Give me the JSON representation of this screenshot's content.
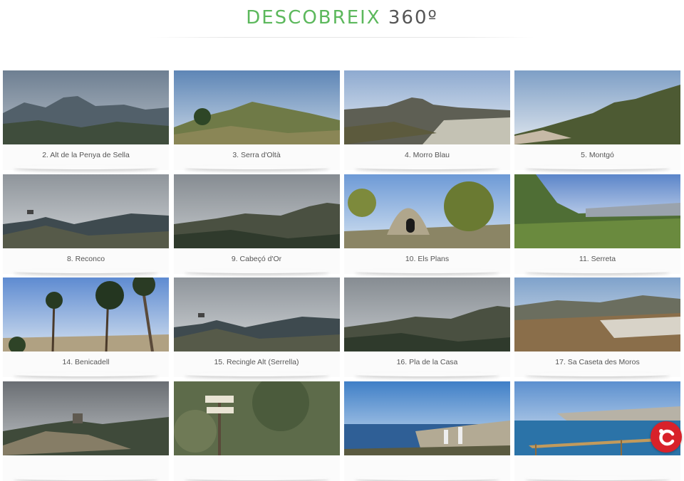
{
  "page": {
    "title_accent": "DESCOBREIX",
    "title_rest": "360º"
  },
  "cards": [
    {
      "label": "2. Alt de la Penya de Sella",
      "scene": "mountain"
    },
    {
      "label": "3. Serra d'Oltà",
      "scene": "hill"
    },
    {
      "label": "4. Morro Blau",
      "scene": "peak-sea"
    },
    {
      "label": "5. Montgó",
      "scene": "ridge-cloud"
    },
    {
      "label": "8. Reconco",
      "scene": "overcast-ridge"
    },
    {
      "label": "9. Cabeçó d'Or",
      "scene": "overcast-rocks"
    },
    {
      "label": "10. Els Plans",
      "scene": "stone-hut"
    },
    {
      "label": "11. Serreta",
      "scene": "green-valley"
    },
    {
      "label": "14. Benicadell",
      "scene": "pines"
    },
    {
      "label": "15. Recingle Alt (Serrella)",
      "scene": "overcast-ridge"
    },
    {
      "label": "16. Pla de la Casa",
      "scene": "overcast-rocks"
    },
    {
      "label": "17. Sa Caseta des Moros",
      "scene": "village"
    },
    {
      "label": "",
      "scene": "summit-ruin"
    },
    {
      "label": "",
      "scene": "signpost"
    },
    {
      "label": "",
      "scene": "coast-city"
    },
    {
      "label": "",
      "scene": "coast-bay"
    }
  ],
  "logo": {
    "icon": "c-logo-icon",
    "color": "#d8212a"
  }
}
